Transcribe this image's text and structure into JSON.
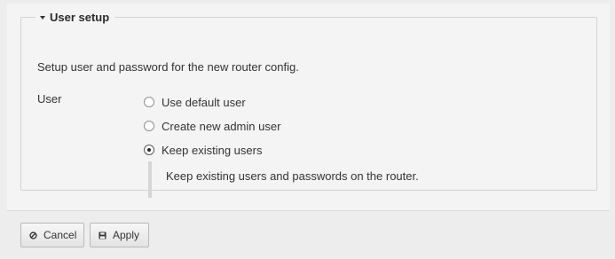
{
  "section": {
    "title": "User setup",
    "expanded": true,
    "intro": "Setup user and password for the new router config."
  },
  "user_field": {
    "label": "User",
    "options": [
      {
        "label": "Use default user",
        "selected": false
      },
      {
        "label": "Create new admin user",
        "selected": false
      },
      {
        "label": "Keep existing users",
        "selected": true
      }
    ],
    "help_text": "Keep existing users and passwords on the router."
  },
  "buttons": {
    "cancel": {
      "label": "Cancel",
      "icon": "cancel-icon"
    },
    "apply": {
      "label": "Apply",
      "icon": "save-icon"
    }
  }
}
